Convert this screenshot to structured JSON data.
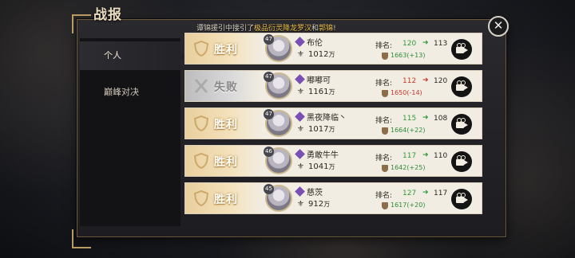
{
  "window": {
    "title": "战报",
    "close_icon": "close-icon"
  },
  "notice": {
    "prefix": "谭锦援引中接引了",
    "hl1": "极品衍灵降龙罗汉",
    "mid": "和",
    "hl2": "郭锦",
    "suffix": "!"
  },
  "tabs": [
    {
      "label": "个人",
      "active": true
    },
    {
      "label": "巅峰对决",
      "active": false
    }
  ],
  "rank_label": "排名:",
  "power_unit": "万",
  "colors": {
    "win": "#f4e2bd",
    "lose": "#d9d9d9",
    "up": "#2e9b3a",
    "down": "#c9342a",
    "gold": "#f1c44a"
  },
  "records": [
    {
      "result": "胜利",
      "outcome": "win",
      "level": "47",
      "name": "布伦",
      "power": "1012",
      "rank_from": "120",
      "rank_to": "113",
      "trend": "up",
      "score": "1663(+13)"
    },
    {
      "result": "失败",
      "outcome": "lose",
      "level": "47",
      "name": "嘟嘟可",
      "power": "1161",
      "rank_from": "112",
      "rank_to": "120",
      "trend": "down",
      "score": "1650(-14)"
    },
    {
      "result": "胜利",
      "outcome": "win",
      "level": "47",
      "name": "黑夜降临丶",
      "power": "1017",
      "rank_from": "115",
      "rank_to": "108",
      "trend": "up",
      "score": "1664(+22)"
    },
    {
      "result": "胜利",
      "outcome": "win",
      "level": "46",
      "name": "勇敢牛牛",
      "power": "1041",
      "rank_from": "117",
      "rank_to": "110",
      "trend": "up",
      "score": "1642(+25)"
    },
    {
      "result": "胜利",
      "outcome": "win",
      "level": "45",
      "name": "慈茨",
      "power": "912",
      "rank_from": "127",
      "rank_to": "117",
      "trend": "up",
      "score": "1617(+20)"
    }
  ]
}
